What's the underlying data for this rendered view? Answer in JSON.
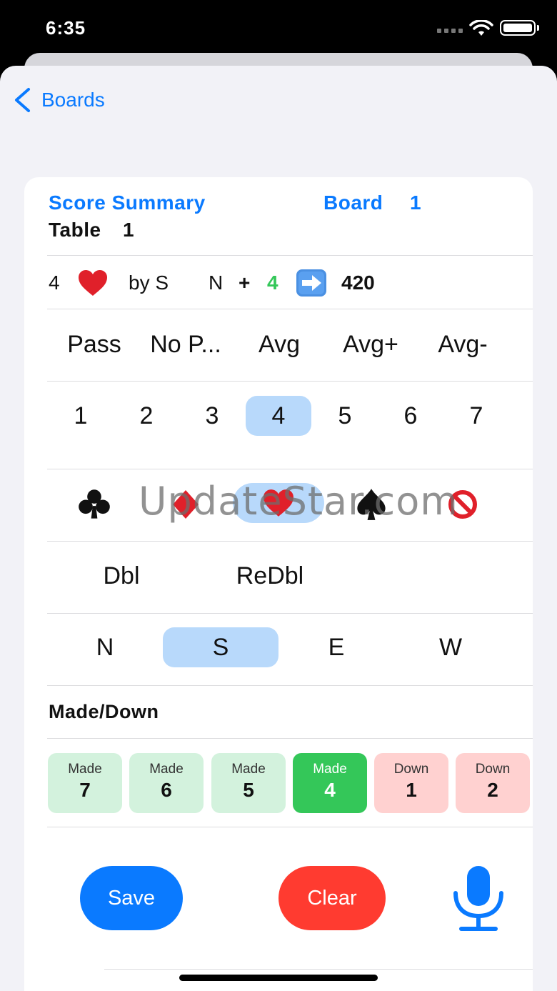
{
  "status": {
    "time": "6:35"
  },
  "nav": {
    "back_label": "Boards"
  },
  "header": {
    "title": "Score Summary",
    "board_label": "Board",
    "board_number": "1",
    "table_label": "Table",
    "table_number": "1"
  },
  "contract": {
    "level": "4",
    "suit_icon": "heart",
    "by_label": "by S",
    "declarer_side": "N",
    "plus_sign": "+",
    "tricks": "4",
    "arrow_icon": "right-arrow",
    "score": "420",
    "tricks_color": "#34c759"
  },
  "special_calls": [
    "Pass",
    "No P...",
    "Avg",
    "Avg+",
    "Avg-"
  ],
  "levels": {
    "items": [
      "1",
      "2",
      "3",
      "4",
      "5",
      "6",
      "7"
    ],
    "selected": "4"
  },
  "suits": {
    "items": [
      "club",
      "diamond",
      "heart",
      "spade",
      "no-trump"
    ],
    "selected": "heart"
  },
  "doubles": [
    "Dbl",
    "ReDbl"
  ],
  "directions": {
    "items": [
      "N",
      "S",
      "E",
      "W"
    ],
    "selected": "S"
  },
  "made_down": {
    "title": "Made/Down",
    "buttons": [
      {
        "label": "Made",
        "value": "7",
        "kind": "made"
      },
      {
        "label": "Made",
        "value": "6",
        "kind": "made"
      },
      {
        "label": "Made",
        "value": "5",
        "kind": "made"
      },
      {
        "label": "Made",
        "value": "4",
        "kind": "made-selected"
      },
      {
        "label": "Down",
        "value": "1",
        "kind": "down"
      },
      {
        "label": "Down",
        "value": "2",
        "kind": "down"
      }
    ]
  },
  "actions": {
    "save_label": "Save",
    "clear_label": "Clear"
  },
  "watermark": "UpdateStar.com",
  "colors": {
    "accent": "#0a7aff",
    "selected_bg": "#b8d9fb",
    "made_bg": "#d3f2dd",
    "made_selected": "#34c759",
    "down_bg": "#ffd1d0",
    "clear": "#ff3b30"
  }
}
